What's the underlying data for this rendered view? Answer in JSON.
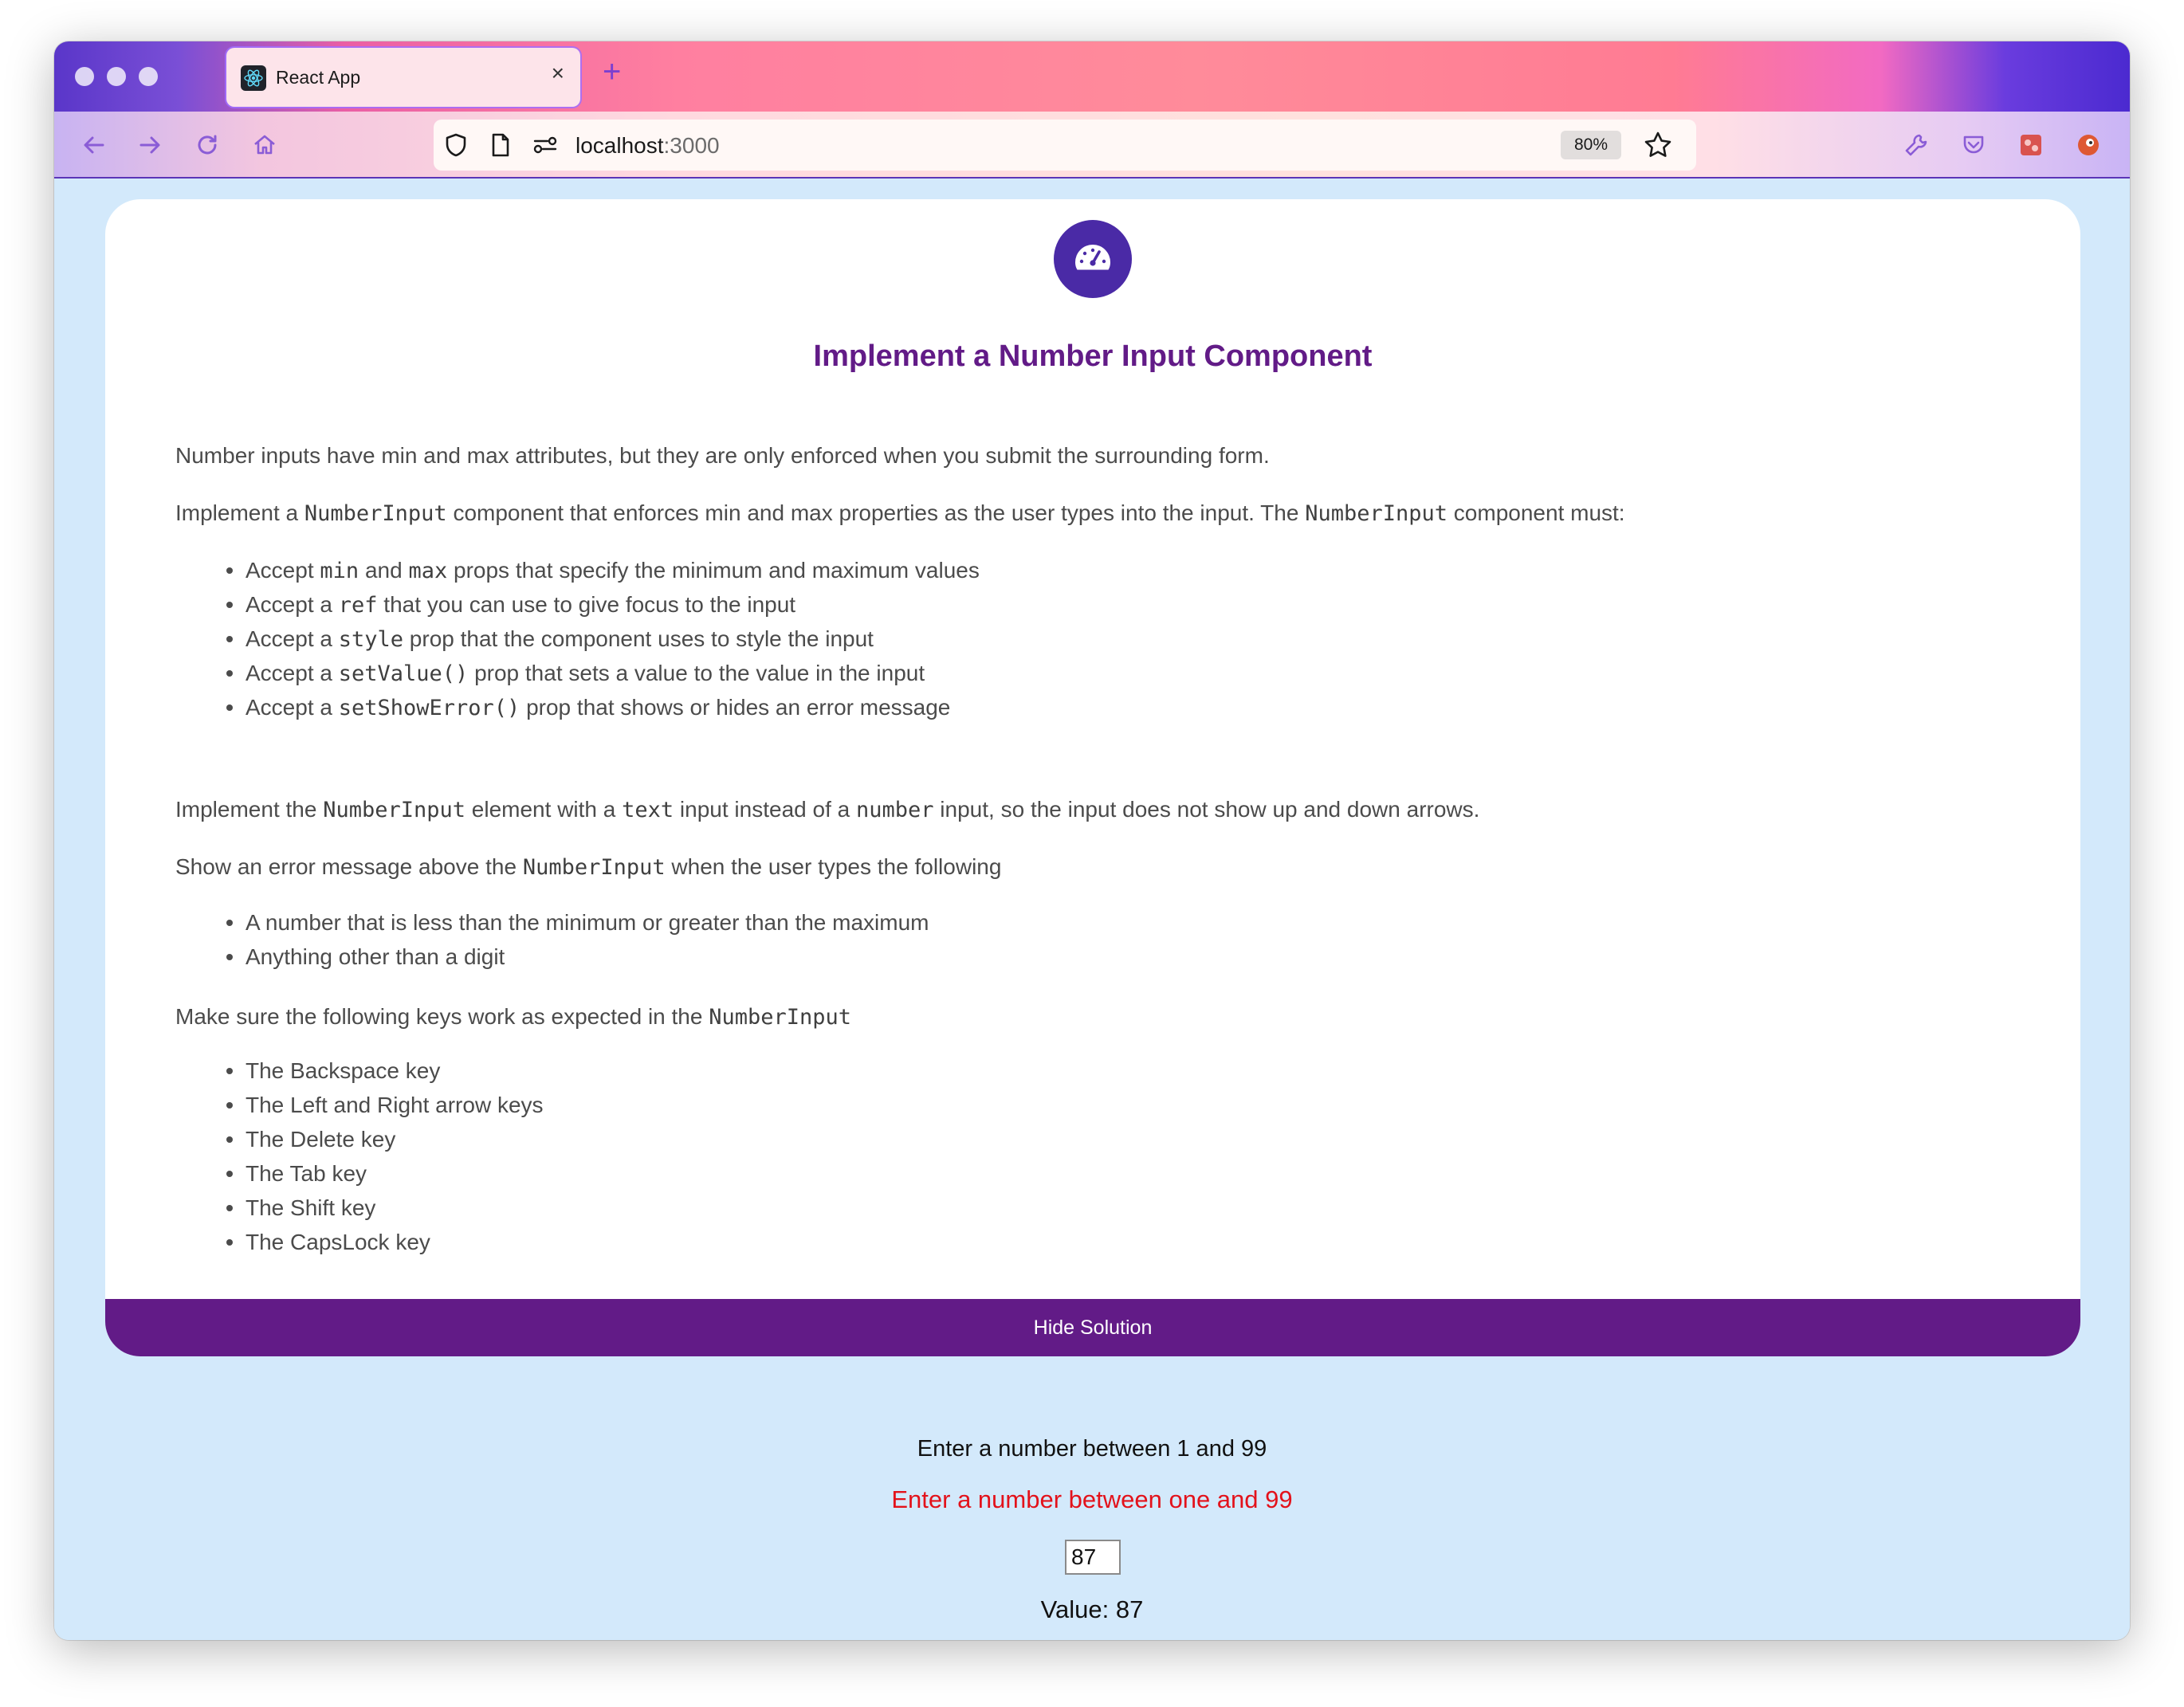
{
  "browser": {
    "tab_title": "React App",
    "tab_close": "×",
    "new_tab": "+",
    "url_host": "localhost",
    "url_port": ":3000",
    "zoom": "80%"
  },
  "card": {
    "title": "Implement a Number Input Component",
    "p1": "Number inputs have min and max attributes, but they are only enforced when you submit the surrounding form.",
    "p2": {
      "a": "Implement a ",
      "code1": "NumberInput",
      "b": " component that enforces min and max properties as the user types into the input. The ",
      "code2": "NumberInput",
      "c": " component must:"
    },
    "list1": [
      {
        "a": "Accept ",
        "c1": "min",
        "b": " and ",
        "c2": "max",
        "d": " props that specify the minimum and maximum values"
      },
      {
        "a": "Accept a ",
        "c1": "ref",
        "b": " that you can use to give focus to the input"
      },
      {
        "a": "Accept a ",
        "c1": "style",
        "b": " prop that the component uses to style the input"
      },
      {
        "a": "Accept a ",
        "c1": "setValue()",
        "b": " prop that sets a value to the value in the input"
      },
      {
        "a": "Accept a ",
        "c1": "setShowError()",
        "b": " prop that shows or hides an error message"
      }
    ],
    "p3": {
      "a": "Implement the ",
      "code1": "NumberInput",
      "b": " element with a ",
      "code2": "text",
      "c": " input instead of a ",
      "code3": "number",
      "d": " input, so the input does not show up and down arrows."
    },
    "p4": {
      "a": "Show an error message above the ",
      "code1": "NumberInput",
      "b": " when the user types the following"
    },
    "list2": [
      "A number that is less than the minimum or greater than the maximum",
      "Anything other than a digit"
    ],
    "p5": {
      "a": "Make sure the following keys work as expected in the ",
      "code1": "NumberInput"
    },
    "list3": [
      "The Backspace key",
      "The Left and Right arrow keys",
      "The Delete key",
      "The Tab key",
      "The Shift key",
      "The CapsLock key"
    ],
    "hide_button": "Hide Solution"
  },
  "demo": {
    "prompt": "Enter a number between 1 and 99",
    "error": "Enter a number between one and 99",
    "input_value": "87",
    "value_text": "Value: 87"
  },
  "colors": {
    "accent": "#621b87",
    "badge": "#4a2aa6",
    "error": "#e3121b",
    "background": "#d3e9fb"
  }
}
